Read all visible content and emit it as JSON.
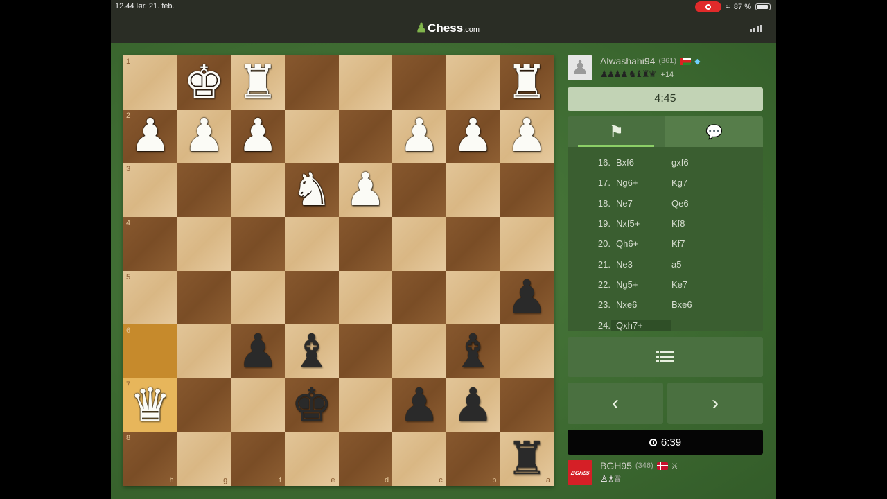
{
  "status_bar": {
    "time_date": "12.44  lør. 21. feb.",
    "battery": "87 %",
    "battery_level": 0.87
  },
  "app": {
    "logo_main": "Chess",
    "logo_suffix": ".com"
  },
  "opponent": {
    "name": "Alwashahi94",
    "rating": "(361)",
    "flag": "Oman",
    "badge_icon": "diamond-icon",
    "captured_pieces": "♟♟♟♟ ♞♝♜♛",
    "material_advantage": "+14",
    "clock": "4:45"
  },
  "player": {
    "name": "BGH95",
    "rating": "(346)",
    "flag": "Denmark",
    "badge_icon": "crossed-swords-icon",
    "avatar_text": "BGH95",
    "captured_pieces": "♙♗♕",
    "clock": "6:39"
  },
  "tabs": [
    {
      "name": "moves",
      "icon": "flag-icon"
    },
    {
      "name": "chat",
      "icon": "chat-icon"
    }
  ],
  "moves": [
    {
      "num": "16.",
      "white": "Bxf6",
      "black": "gxf6"
    },
    {
      "num": "17.",
      "white": "Ng6+",
      "black": "Kg7"
    },
    {
      "num": "18.",
      "white": "Ne7",
      "black": "Qe6"
    },
    {
      "num": "19.",
      "white": "Nxf5+",
      "black": "Kf8"
    },
    {
      "num": "20.",
      "white": "Qh6+",
      "black": "Kf7"
    },
    {
      "num": "21.",
      "white": "Ne3",
      "black": "a5"
    },
    {
      "num": "22.",
      "white": "Ng5+",
      "black": "Ke7"
    },
    {
      "num": "23.",
      "white": "Nxe6",
      "black": "Bxe6"
    },
    {
      "num": "24.",
      "white": "Qxh7+",
      "black": ""
    }
  ],
  "board": {
    "ranks": [
      "1",
      "2",
      "3",
      "4",
      "5",
      "6",
      "7",
      "8"
    ],
    "files": [
      "h",
      "g",
      "f",
      "e",
      "d",
      "c",
      "b",
      "a"
    ],
    "pieces": [
      [
        null,
        "wK",
        "wR",
        null,
        null,
        null,
        null,
        "wR"
      ],
      [
        "wP",
        "wP",
        "wP",
        null,
        null,
        "wP",
        "wP",
        "wP"
      ],
      [
        null,
        null,
        null,
        "wN",
        "wP",
        null,
        null,
        null
      ],
      [
        null,
        null,
        null,
        null,
        null,
        null,
        null,
        null
      ],
      [
        null,
        null,
        null,
        null,
        null,
        null,
        null,
        "bP"
      ],
      [
        null,
        null,
        "bP",
        "bB",
        null,
        null,
        "bB",
        null
      ],
      [
        "wQ",
        null,
        null,
        "bK",
        null,
        "bP",
        "bP",
        null
      ],
      [
        null,
        null,
        null,
        null,
        null,
        null,
        null,
        "bR"
      ]
    ],
    "highlighted": [
      "h6",
      "h7"
    ]
  }
}
